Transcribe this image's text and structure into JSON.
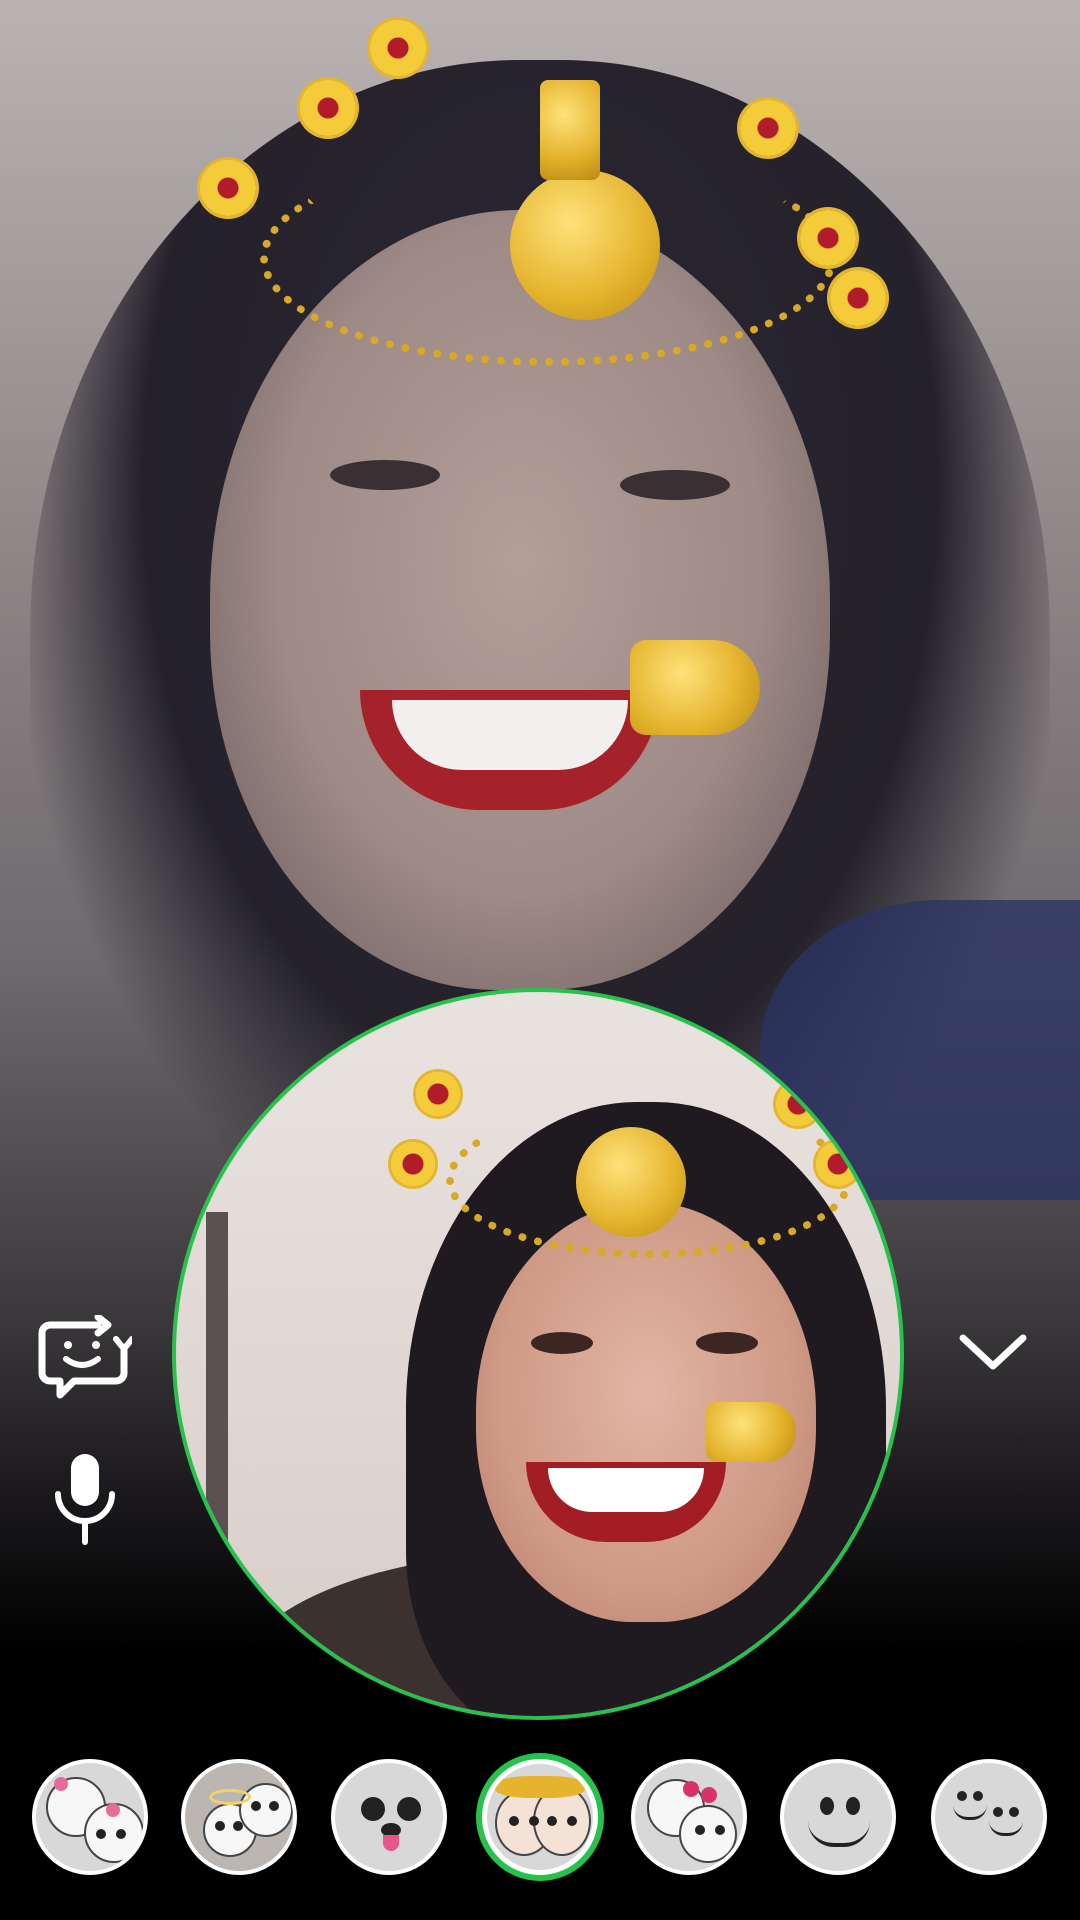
{
  "call": {
    "remote_video_label": "",
    "local_preview_label": ""
  },
  "controls": {
    "swap_face_icon": "face-swap-icon",
    "mic_icon": "microphone-icon",
    "collapse_icon": "chevron-down-icon"
  },
  "filters": {
    "selected_index": 3,
    "items": [
      {
        "icon": "glasses-flowers-faces-icon"
      },
      {
        "icon": "angel-halo-faces-icon"
      },
      {
        "icon": "puppy-face-icon"
      },
      {
        "icon": "gold-jewelry-faces-icon"
      },
      {
        "icon": "hearts-faces-icon"
      },
      {
        "icon": "smile-face-icon"
      },
      {
        "icon": "multi-smile-faces-icon"
      }
    ]
  },
  "colors": {
    "accent_green": "#27c24c",
    "icon_white": "#ffffff"
  }
}
